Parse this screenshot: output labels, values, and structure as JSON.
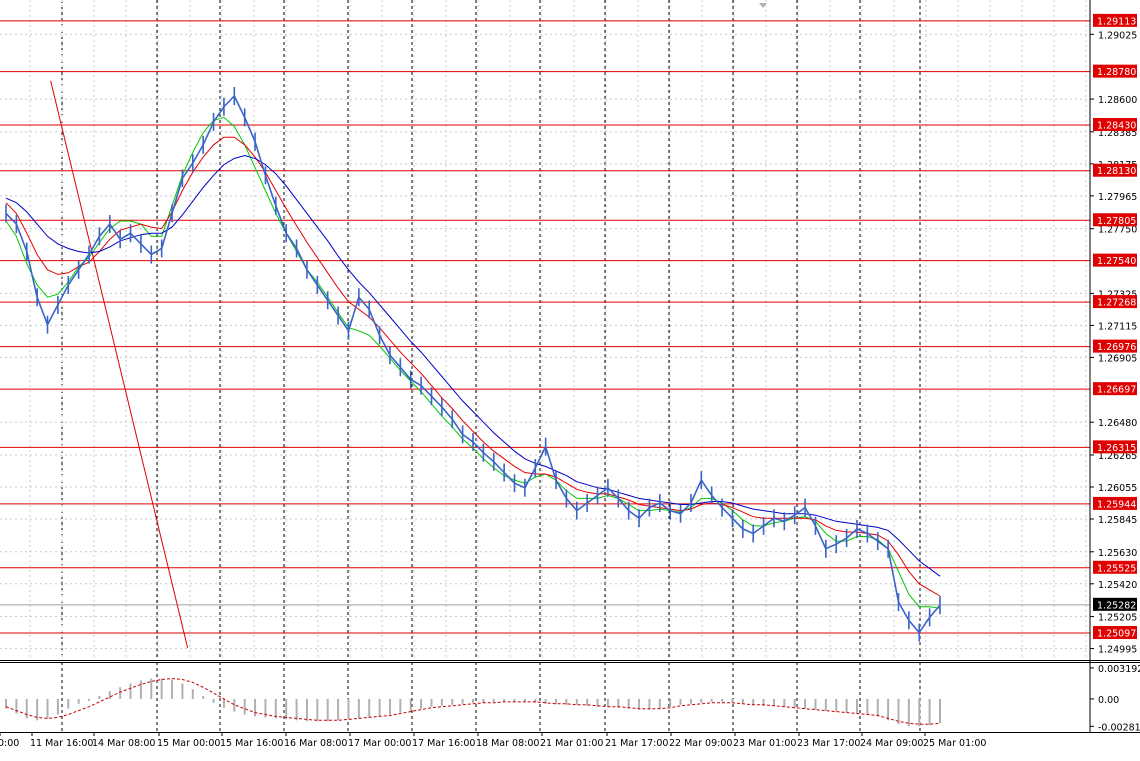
{
  "colors": {
    "background": "#ffffff",
    "grid": "#c8c8c8",
    "axis": "#000000",
    "price_line": "#3a64c8",
    "ma_fast": "#00c800",
    "ma_mid": "#e00000",
    "ma_slow": "#0000c8",
    "level": "#e00000",
    "trendline": "#e00000",
    "osc_hist": "#b0b0b0",
    "osc_signal": "#c80000"
  },
  "chart_data": [
    {
      "type": "line",
      "title": "",
      "price_axis": {
        "min": 1.2492,
        "max": 1.2925,
        "ticks": [
          "1.29025",
          "1.28600",
          "1.28385",
          "1.28175",
          "1.27965",
          "1.27750",
          "1.27325",
          "1.27115",
          "1.26905",
          "1.26480",
          "1.26265",
          "1.26055",
          "1.25845",
          "1.25630",
          "1.25420",
          "1.25205",
          "1.24995"
        ]
      },
      "time_axis": {
        "labels": [
          "0:00",
          "11 Mar 16:00",
          "14 Mar 08:00",
          "15 Mar 00:00",
          "15 Mar 16:00",
          "16 Mar 08:00",
          "17 Mar 00:00",
          "17 Mar 16:00",
          "18 Mar 08:00",
          "21 Mar 01:00",
          "21 Mar 17:00",
          "22 Mar 09:00",
          "23 Mar 01:00",
          "23 Mar 17:00",
          "24 Mar 09:00",
          "25 Mar 01:00"
        ]
      },
      "levels": [
        "1.29113",
        "1.28780",
        "1.28430",
        "1.28130",
        "1.27805",
        "1.27540",
        "1.27268",
        "1.26976",
        "1.26697",
        "1.26315",
        "1.25944",
        "1.25525",
        "1.25097"
      ],
      "current_price": "1.25282",
      "trendline": {
        "from": [
          4.3,
          1.2872
        ],
        "to": [
          17.5,
          1.25
        ]
      },
      "series": [
        {
          "values": [
            1.2785,
            1.2778,
            1.276,
            1.273,
            1.2712,
            1.2725,
            1.2738,
            1.2748,
            1.2758,
            1.277,
            1.2778,
            1.2768,
            1.2772,
            1.2765,
            1.2758,
            1.2762,
            1.2785,
            1.2808,
            1.2818,
            1.283,
            1.2845,
            1.2855,
            1.2862,
            1.2848,
            1.2832,
            1.281,
            1.279,
            1.2772,
            1.2762,
            1.2748,
            1.2738,
            1.2728,
            1.2718,
            1.2708,
            1.273,
            1.2722,
            1.2705,
            1.2692,
            1.2684,
            1.2676,
            1.2672,
            1.2665,
            1.2658,
            1.265,
            1.264,
            1.2635,
            1.2628,
            1.2622,
            1.2615,
            1.2608,
            1.2605,
            1.2618,
            1.2632,
            1.261,
            1.2598,
            1.259,
            1.2595,
            1.26,
            1.2605,
            1.2598,
            1.259,
            1.2585,
            1.2592,
            1.2595,
            1.259,
            1.2588,
            1.2595,
            1.261,
            1.26,
            1.2592,
            1.2585,
            1.2578,
            1.2575,
            1.258,
            1.2585,
            1.2583,
            1.2587,
            1.2592,
            1.258,
            1.2565,
            1.2568,
            1.2572,
            1.2578,
            1.2575,
            1.257,
            1.2565,
            1.253,
            1.2518,
            1.251,
            1.252,
            1.2528
          ]
        },
        {
          "name": "",
          "values": [
            1.278,
            1.277,
            1.2752,
            1.2738,
            1.273,
            1.2732,
            1.274,
            1.275,
            1.2756,
            1.2766,
            1.2775,
            1.278,
            1.278,
            1.2778,
            1.277,
            1.277,
            1.279,
            1.281,
            1.2825,
            1.2838,
            1.2846,
            1.2848,
            1.2842,
            1.283,
            1.2815,
            1.28,
            1.2785,
            1.2772,
            1.276,
            1.2748,
            1.274,
            1.273,
            1.272,
            1.271,
            1.2708,
            1.2705,
            1.2698,
            1.269,
            1.2682,
            1.2675,
            1.2668,
            1.266,
            1.2652,
            1.2645,
            1.2637,
            1.2631,
            1.2624,
            1.2618,
            1.2613,
            1.261,
            1.2608,
            1.2612,
            1.2614,
            1.261,
            1.2603,
            1.2598,
            1.2598,
            1.2598,
            1.26,
            1.2598,
            1.2594,
            1.259,
            1.259,
            1.2591,
            1.259,
            1.2589,
            1.2592,
            1.2598,
            1.2598,
            1.2595,
            1.259,
            1.2584,
            1.258,
            1.258,
            1.2582,
            1.2583,
            1.2585,
            1.2586,
            1.2583,
            1.2575,
            1.257,
            1.257,
            1.2573,
            1.2573,
            1.2571,
            1.2565,
            1.255,
            1.2535,
            1.2527,
            1.2527,
            1.2526
          ]
        },
        {
          "name": "",
          "values": [
            1.2792,
            1.2785,
            1.2772,
            1.2758,
            1.2748,
            1.2745,
            1.2746,
            1.275,
            1.2753,
            1.276,
            1.2768,
            1.2774,
            1.2776,
            1.2778,
            1.2776,
            1.2775,
            1.2786,
            1.28,
            1.2812,
            1.2822,
            1.283,
            1.2835,
            1.2835,
            1.283,
            1.2822,
            1.2812,
            1.28,
            1.2788,
            1.2777,
            1.2766,
            1.2756,
            1.2746,
            1.2736,
            1.2727,
            1.2722,
            1.2717,
            1.271,
            1.2702,
            1.2694,
            1.2687,
            1.268,
            1.2672,
            1.2664,
            1.2657,
            1.2649,
            1.2642,
            1.2635,
            1.2629,
            1.2624,
            1.2619,
            1.2615,
            1.2614,
            1.2614,
            1.2612,
            1.2608,
            1.2604,
            1.2602,
            1.2601,
            1.2601,
            1.2599,
            1.2597,
            1.2594,
            1.2593,
            1.2592,
            1.2591,
            1.259,
            1.2591,
            1.2594,
            1.2595,
            1.2594,
            1.2592,
            1.2589,
            1.2586,
            1.2585,
            1.2585,
            1.2585,
            1.2585,
            1.2585,
            1.2584,
            1.258,
            1.2577,
            1.2576,
            1.2576,
            1.2575,
            1.2574,
            1.257,
            1.2561,
            1.255,
            1.2542,
            1.2538,
            1.2534
          ]
        },
        {
          "name": "",
          "values": [
            1.2795,
            1.2792,
            1.2786,
            1.2778,
            1.277,
            1.2765,
            1.2762,
            1.276,
            1.2759,
            1.276,
            1.2763,
            1.2767,
            1.2769,
            1.2771,
            1.2772,
            1.2772,
            1.2776,
            1.2784,
            1.2793,
            1.2802,
            1.281,
            1.2817,
            1.2821,
            1.2823,
            1.2821,
            1.2817,
            1.2811,
            1.2803,
            1.2794,
            1.2785,
            1.2776,
            1.2767,
            1.2757,
            1.2748,
            1.274,
            1.2733,
            1.2725,
            1.2717,
            1.2709,
            1.2701,
            1.2694,
            1.2686,
            1.2678,
            1.267,
            1.2662,
            1.2655,
            1.2648,
            1.2641,
            1.2635,
            1.2629,
            1.2624,
            1.2621,
            1.2619,
            1.2616,
            1.2613,
            1.2609,
            1.2607,
            1.2605,
            1.2604,
            1.2602,
            1.26,
            1.2598,
            1.2597,
            1.2596,
            1.2595,
            1.2594,
            1.2594,
            1.2595,
            1.2596,
            1.2596,
            1.2595,
            1.2593,
            1.2591,
            1.259,
            1.2589,
            1.2588,
            1.2588,
            1.2588,
            1.2587,
            1.2585,
            1.2583,
            1.2582,
            1.2581,
            1.258,
            1.2579,
            1.2577,
            1.2571,
            1.2564,
            1.2557,
            1.2552,
            1.2547
          ]
        }
      ]
    },
    {
      "type": "area",
      "title": "",
      "y_ticks": [
        "0.003192",
        "0.00",
        "-0.002817"
      ],
      "ylim": [
        -0.0034,
        0.0038
      ],
      "series": [
        {
          "name": "",
          "values": [
            -0.001,
            -0.0015,
            -0.002,
            -0.0022,
            -0.002,
            -0.0016,
            -0.001,
            -0.0005,
            -0.0002,
            0.0003,
            0.0008,
            0.0012,
            0.0016,
            0.0019,
            0.0021,
            0.0021,
            0.002,
            0.0016,
            0.001,
            0.0003,
            -0.0004,
            -0.0009,
            -0.0013,
            -0.0016,
            -0.0018,
            -0.0019,
            -0.002,
            -0.0021,
            -0.0022,
            -0.0023,
            -0.0023,
            -0.0023,
            -0.0022,
            -0.0021,
            -0.002,
            -0.0019,
            -0.0018,
            -0.0016,
            -0.0014,
            -0.0012,
            -0.001,
            -0.0008,
            -0.0007,
            -0.0006,
            -0.0005,
            -0.0004,
            -0.0004,
            -0.0003,
            -0.0003,
            -0.0003,
            -0.0003,
            -0.0004,
            -0.0005,
            -0.0005,
            -0.0006,
            -0.0006,
            -0.0007,
            -0.0008,
            -0.0008,
            -0.0009,
            -0.001,
            -0.0011,
            -0.0011,
            -0.001,
            -0.0008,
            -0.0006,
            -0.0005,
            -0.0004,
            -0.0003,
            -0.0003,
            -0.0004,
            -0.0005,
            -0.0006,
            -0.0007,
            -0.0007,
            -0.0008,
            -0.0009,
            -0.001,
            -0.0011,
            -0.0012,
            -0.0013,
            -0.0014,
            -0.0015,
            -0.0016,
            -0.0018,
            -0.0022,
            -0.0026,
            -0.0028,
            -0.0028,
            -0.0027,
            -0.0025
          ]
        },
        {
          "name": "",
          "values": [
            -0.0008,
            -0.0012,
            -0.0016,
            -0.0019,
            -0.002,
            -0.0019,
            -0.0016,
            -0.0012,
            -0.0008,
            -0.0003,
            0.0002,
            0.0007,
            0.0011,
            0.0015,
            0.0018,
            0.002,
            0.0021,
            0.002,
            0.0017,
            0.0012,
            0.0006,
            0.0,
            -0.0006,
            -0.001,
            -0.0014,
            -0.0016,
            -0.0018,
            -0.0019,
            -0.002,
            -0.0021,
            -0.0022,
            -0.0022,
            -0.0022,
            -0.0021,
            -0.002,
            -0.0019,
            -0.0018,
            -0.0017,
            -0.0015,
            -0.0013,
            -0.0011,
            -0.0009,
            -0.0008,
            -0.0007,
            -0.0006,
            -0.0005,
            -0.0004,
            -0.0004,
            -0.0003,
            -0.0003,
            -0.0003,
            -0.0003,
            -0.0004,
            -0.0005,
            -0.0005,
            -0.0006,
            -0.0006,
            -0.0007,
            -0.0008,
            -0.0008,
            -0.0009,
            -0.001,
            -0.001,
            -0.001,
            -0.0009,
            -0.0007,
            -0.0006,
            -0.0005,
            -0.0004,
            -0.0004,
            -0.0004,
            -0.0005,
            -0.0006,
            -0.0006,
            -0.0007,
            -0.0008,
            -0.0009,
            -0.001,
            -0.0011,
            -0.0012,
            -0.0013,
            -0.0014,
            -0.0015,
            -0.0016,
            -0.0017,
            -0.002,
            -0.0023,
            -0.0025,
            -0.0026,
            -0.0026,
            -0.0025
          ]
        }
      ]
    }
  ]
}
